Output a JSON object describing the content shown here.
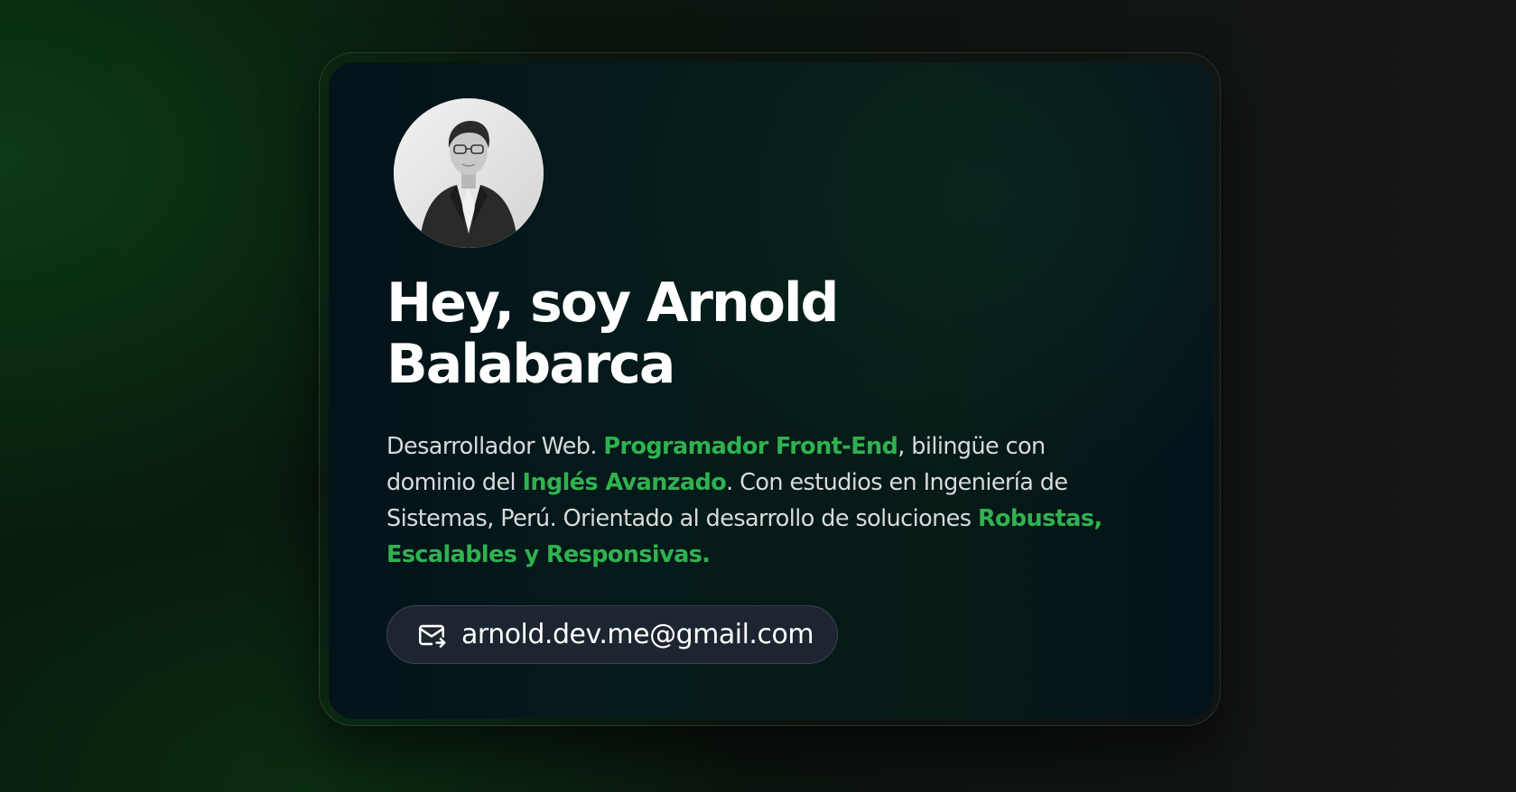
{
  "profile": {
    "title_line1": "Hey, soy Arnold",
    "title_line2": "Balabarca",
    "avatar_icon": "profile-photo"
  },
  "description": {
    "part1": "Desarrollador Web. ",
    "highlight1": "Programador Front-End",
    "part2": ", bilingüe con dominio del ",
    "highlight2": "Inglés Avanzado",
    "part3": ". Con estudios en Ingeniería de Sistemas, Perú. Orientado al desarrollo de soluciones ",
    "highlight3": "Robustas, Escalables y Responsivas."
  },
  "contact": {
    "email": "arnold.dev.me@gmail.com",
    "icon": "mail-icon"
  },
  "colors": {
    "accent": "#2fb24f",
    "title": "#ffffff",
    "text": "#d8dadc",
    "button_bg": "#1c2530"
  }
}
